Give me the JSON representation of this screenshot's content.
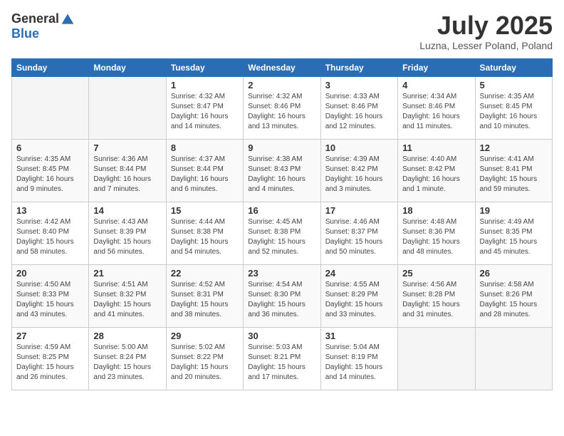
{
  "logo": {
    "general": "General",
    "blue": "Blue"
  },
  "title": {
    "month": "July 2025",
    "location": "Luzna, Lesser Poland, Poland"
  },
  "weekdays": [
    "Sunday",
    "Monday",
    "Tuesday",
    "Wednesday",
    "Thursday",
    "Friday",
    "Saturday"
  ],
  "weeks": [
    [
      {
        "day": "",
        "empty": true
      },
      {
        "day": "",
        "empty": true
      },
      {
        "day": "1",
        "sunrise": "4:32 AM",
        "sunset": "8:47 PM",
        "daylight": "16 hours and 14 minutes."
      },
      {
        "day": "2",
        "sunrise": "4:32 AM",
        "sunset": "8:46 PM",
        "daylight": "16 hours and 13 minutes."
      },
      {
        "day": "3",
        "sunrise": "4:33 AM",
        "sunset": "8:46 PM",
        "daylight": "16 hours and 12 minutes."
      },
      {
        "day": "4",
        "sunrise": "4:34 AM",
        "sunset": "8:46 PM",
        "daylight": "16 hours and 11 minutes."
      },
      {
        "day": "5",
        "sunrise": "4:35 AM",
        "sunset": "8:45 PM",
        "daylight": "16 hours and 10 minutes."
      }
    ],
    [
      {
        "day": "6",
        "sunrise": "4:35 AM",
        "sunset": "8:45 PM",
        "daylight": "16 hours and 9 minutes."
      },
      {
        "day": "7",
        "sunrise": "4:36 AM",
        "sunset": "8:44 PM",
        "daylight": "16 hours and 7 minutes."
      },
      {
        "day": "8",
        "sunrise": "4:37 AM",
        "sunset": "8:44 PM",
        "daylight": "16 hours and 6 minutes."
      },
      {
        "day": "9",
        "sunrise": "4:38 AM",
        "sunset": "8:43 PM",
        "daylight": "16 hours and 4 minutes."
      },
      {
        "day": "10",
        "sunrise": "4:39 AM",
        "sunset": "8:42 PM",
        "daylight": "16 hours and 3 minutes."
      },
      {
        "day": "11",
        "sunrise": "4:40 AM",
        "sunset": "8:42 PM",
        "daylight": "16 hours and 1 minute."
      },
      {
        "day": "12",
        "sunrise": "4:41 AM",
        "sunset": "8:41 PM",
        "daylight": "15 hours and 59 minutes."
      }
    ],
    [
      {
        "day": "13",
        "sunrise": "4:42 AM",
        "sunset": "8:40 PM",
        "daylight": "15 hours and 58 minutes."
      },
      {
        "day": "14",
        "sunrise": "4:43 AM",
        "sunset": "8:39 PM",
        "daylight": "15 hours and 56 minutes."
      },
      {
        "day": "15",
        "sunrise": "4:44 AM",
        "sunset": "8:38 PM",
        "daylight": "15 hours and 54 minutes."
      },
      {
        "day": "16",
        "sunrise": "4:45 AM",
        "sunset": "8:38 PM",
        "daylight": "15 hours and 52 minutes."
      },
      {
        "day": "17",
        "sunrise": "4:46 AM",
        "sunset": "8:37 PM",
        "daylight": "15 hours and 50 minutes."
      },
      {
        "day": "18",
        "sunrise": "4:48 AM",
        "sunset": "8:36 PM",
        "daylight": "15 hours and 48 minutes."
      },
      {
        "day": "19",
        "sunrise": "4:49 AM",
        "sunset": "8:35 PM",
        "daylight": "15 hours and 45 minutes."
      }
    ],
    [
      {
        "day": "20",
        "sunrise": "4:50 AM",
        "sunset": "8:33 PM",
        "daylight": "15 hours and 43 minutes."
      },
      {
        "day": "21",
        "sunrise": "4:51 AM",
        "sunset": "8:32 PM",
        "daylight": "15 hours and 41 minutes."
      },
      {
        "day": "22",
        "sunrise": "4:52 AM",
        "sunset": "8:31 PM",
        "daylight": "15 hours and 38 minutes."
      },
      {
        "day": "23",
        "sunrise": "4:54 AM",
        "sunset": "8:30 PM",
        "daylight": "15 hours and 36 minutes."
      },
      {
        "day": "24",
        "sunrise": "4:55 AM",
        "sunset": "8:29 PM",
        "daylight": "15 hours and 33 minutes."
      },
      {
        "day": "25",
        "sunrise": "4:56 AM",
        "sunset": "8:28 PM",
        "daylight": "15 hours and 31 minutes."
      },
      {
        "day": "26",
        "sunrise": "4:58 AM",
        "sunset": "8:26 PM",
        "daylight": "15 hours and 28 minutes."
      }
    ],
    [
      {
        "day": "27",
        "sunrise": "4:59 AM",
        "sunset": "8:25 PM",
        "daylight": "15 hours and 26 minutes."
      },
      {
        "day": "28",
        "sunrise": "5:00 AM",
        "sunset": "8:24 PM",
        "daylight": "15 hours and 23 minutes."
      },
      {
        "day": "29",
        "sunrise": "5:02 AM",
        "sunset": "8:22 PM",
        "daylight": "15 hours and 20 minutes."
      },
      {
        "day": "30",
        "sunrise": "5:03 AM",
        "sunset": "8:21 PM",
        "daylight": "15 hours and 17 minutes."
      },
      {
        "day": "31",
        "sunrise": "5:04 AM",
        "sunset": "8:19 PM",
        "daylight": "15 hours and 14 minutes."
      },
      {
        "day": "",
        "empty": true
      },
      {
        "day": "",
        "empty": true
      }
    ]
  ]
}
